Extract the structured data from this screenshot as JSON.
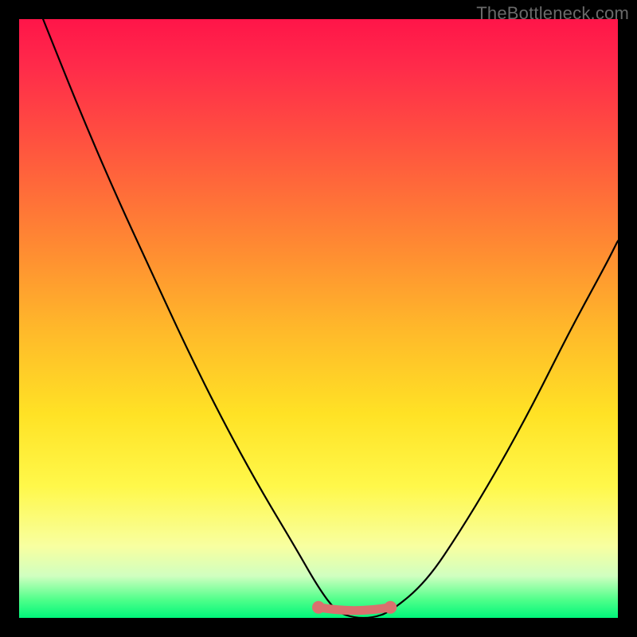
{
  "watermark": "TheBottleneck.com",
  "chart_data": {
    "type": "line",
    "title": "",
    "xlabel": "",
    "ylabel": "",
    "xlim": [
      0,
      100
    ],
    "ylim": [
      0,
      100
    ],
    "series": [
      {
        "name": "bottleneck-curve",
        "x": [
          4,
          10,
          16,
          22,
          28,
          34,
          40,
          46,
          50,
          53,
          56,
          59,
          62,
          68,
          74,
          80,
          86,
          92,
          98,
          100
        ],
        "values": [
          100,
          85,
          71,
          58,
          45,
          33,
          22,
          12,
          5,
          1,
          0,
          0,
          1,
          6,
          15,
          25,
          36,
          48,
          59,
          63
        ]
      }
    ],
    "flat_segment": {
      "comment": "salmon flat region near trough with endpoint dots",
      "x_start": 50,
      "x_end": 62,
      "y": 1.5,
      "color": "#d9716e"
    },
    "gradient_stops": [
      {
        "pos": 0.0,
        "color": "#ff1549"
      },
      {
        "pos": 0.38,
        "color": "#ff8a32"
      },
      {
        "pos": 0.66,
        "color": "#ffe225"
      },
      {
        "pos": 0.93,
        "color": "#d0ffc0"
      },
      {
        "pos": 1.0,
        "color": "#00f57a"
      }
    ]
  }
}
